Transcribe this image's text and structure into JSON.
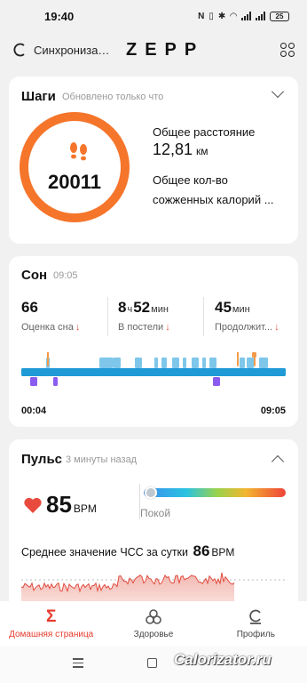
{
  "status_bar": {
    "time": "19:40",
    "battery": "25"
  },
  "app_bar": {
    "sync_label": "Синхронизация...",
    "logo": "ZEPP",
    "sync_icon": "sync-icon",
    "grid_icon": "apps-grid-icon"
  },
  "steps": {
    "title": "Шаги",
    "updated": "Обновлено только что",
    "value": "20011",
    "distance_label": "Общее расстояние",
    "distance_value": "12,81",
    "distance_unit": "км",
    "calories_label_1": "Общее кол-во",
    "calories_label_2": "сожженных калорий ...",
    "ring_color": "#f5752b"
  },
  "sleep": {
    "title": "Сон",
    "time": "09:05",
    "score": {
      "value": "66",
      "label": "Оценка сна"
    },
    "in_bed": {
      "hours": "8",
      "h_unit": "ч",
      "minutes": "52",
      "m_unit": "мин",
      "label": "В постели"
    },
    "duration": {
      "value": "45",
      "unit": "мин",
      "label": "Продолжит..."
    },
    "start": "00:04",
    "end": "09:05",
    "colors": {
      "light": "#1f9ad6",
      "deep": "#7fc7ea",
      "rem": "#8b5cf0",
      "awake": "#f39a4b"
    }
  },
  "pulse": {
    "title": "Пульс",
    "updated": "3 минуты назад",
    "value": "85",
    "unit": "BPM",
    "zone": "Покой",
    "avg_label": "Среднее значение ЧСС за сутки",
    "avg_value": "86",
    "avg_unit": "BPM",
    "color": "#e84a3d"
  },
  "nav": {
    "items": [
      {
        "label": "Домашняя страница",
        "icon": "sigma-home-icon",
        "active": true
      },
      {
        "label": "Здоровье",
        "icon": "health-icon",
        "active": false
      },
      {
        "label": "Профиль",
        "icon": "profile-icon",
        "active": false
      }
    ]
  },
  "watermark": "Calorizator.ru"
}
